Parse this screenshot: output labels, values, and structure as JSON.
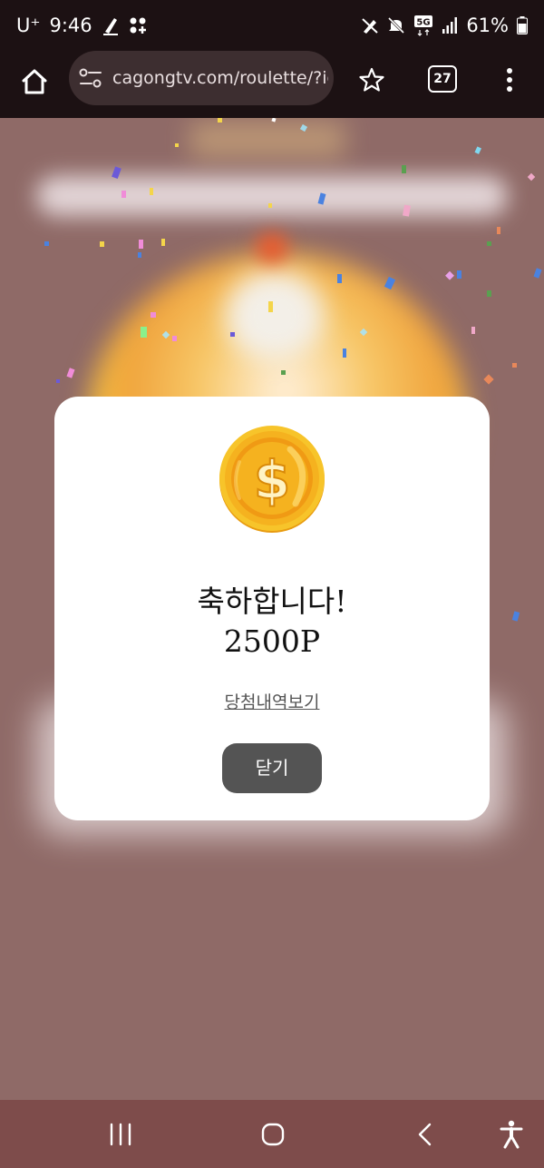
{
  "status_bar": {
    "carrier": "U⁺",
    "time": "9:46",
    "network": "5G",
    "battery": "61%",
    "icons": [
      "pen-app-icon",
      "grid-app-icon",
      "pen-off-icon",
      "mute-icon",
      "5g-icon",
      "signal-icon",
      "battery-icon"
    ]
  },
  "browser": {
    "url": "cagongtv.com/roulette/?ic",
    "tab_count": "27",
    "icons": [
      "home-icon",
      "site-settings-icon",
      "star-icon",
      "tab-switcher",
      "more-menu-icon"
    ]
  },
  "popup": {
    "title": "축하합니다!",
    "points": "2500P",
    "history_link": "당첨내역보기",
    "close_label": "닫기",
    "coin_icon": "dollar-coin-icon"
  },
  "nav_bar": {
    "icons": [
      "recent-apps-icon",
      "home-button-icon",
      "back-icon",
      "accessibility-icon"
    ]
  },
  "colors": {
    "status_bg": "#1c1113",
    "url_pill_bg": "#3d2e30",
    "overlay_bg": "#8f6a67",
    "nav_bg": "#7e4c4b",
    "button_bg": "#545454",
    "coin_gold": "#f5b21f"
  }
}
